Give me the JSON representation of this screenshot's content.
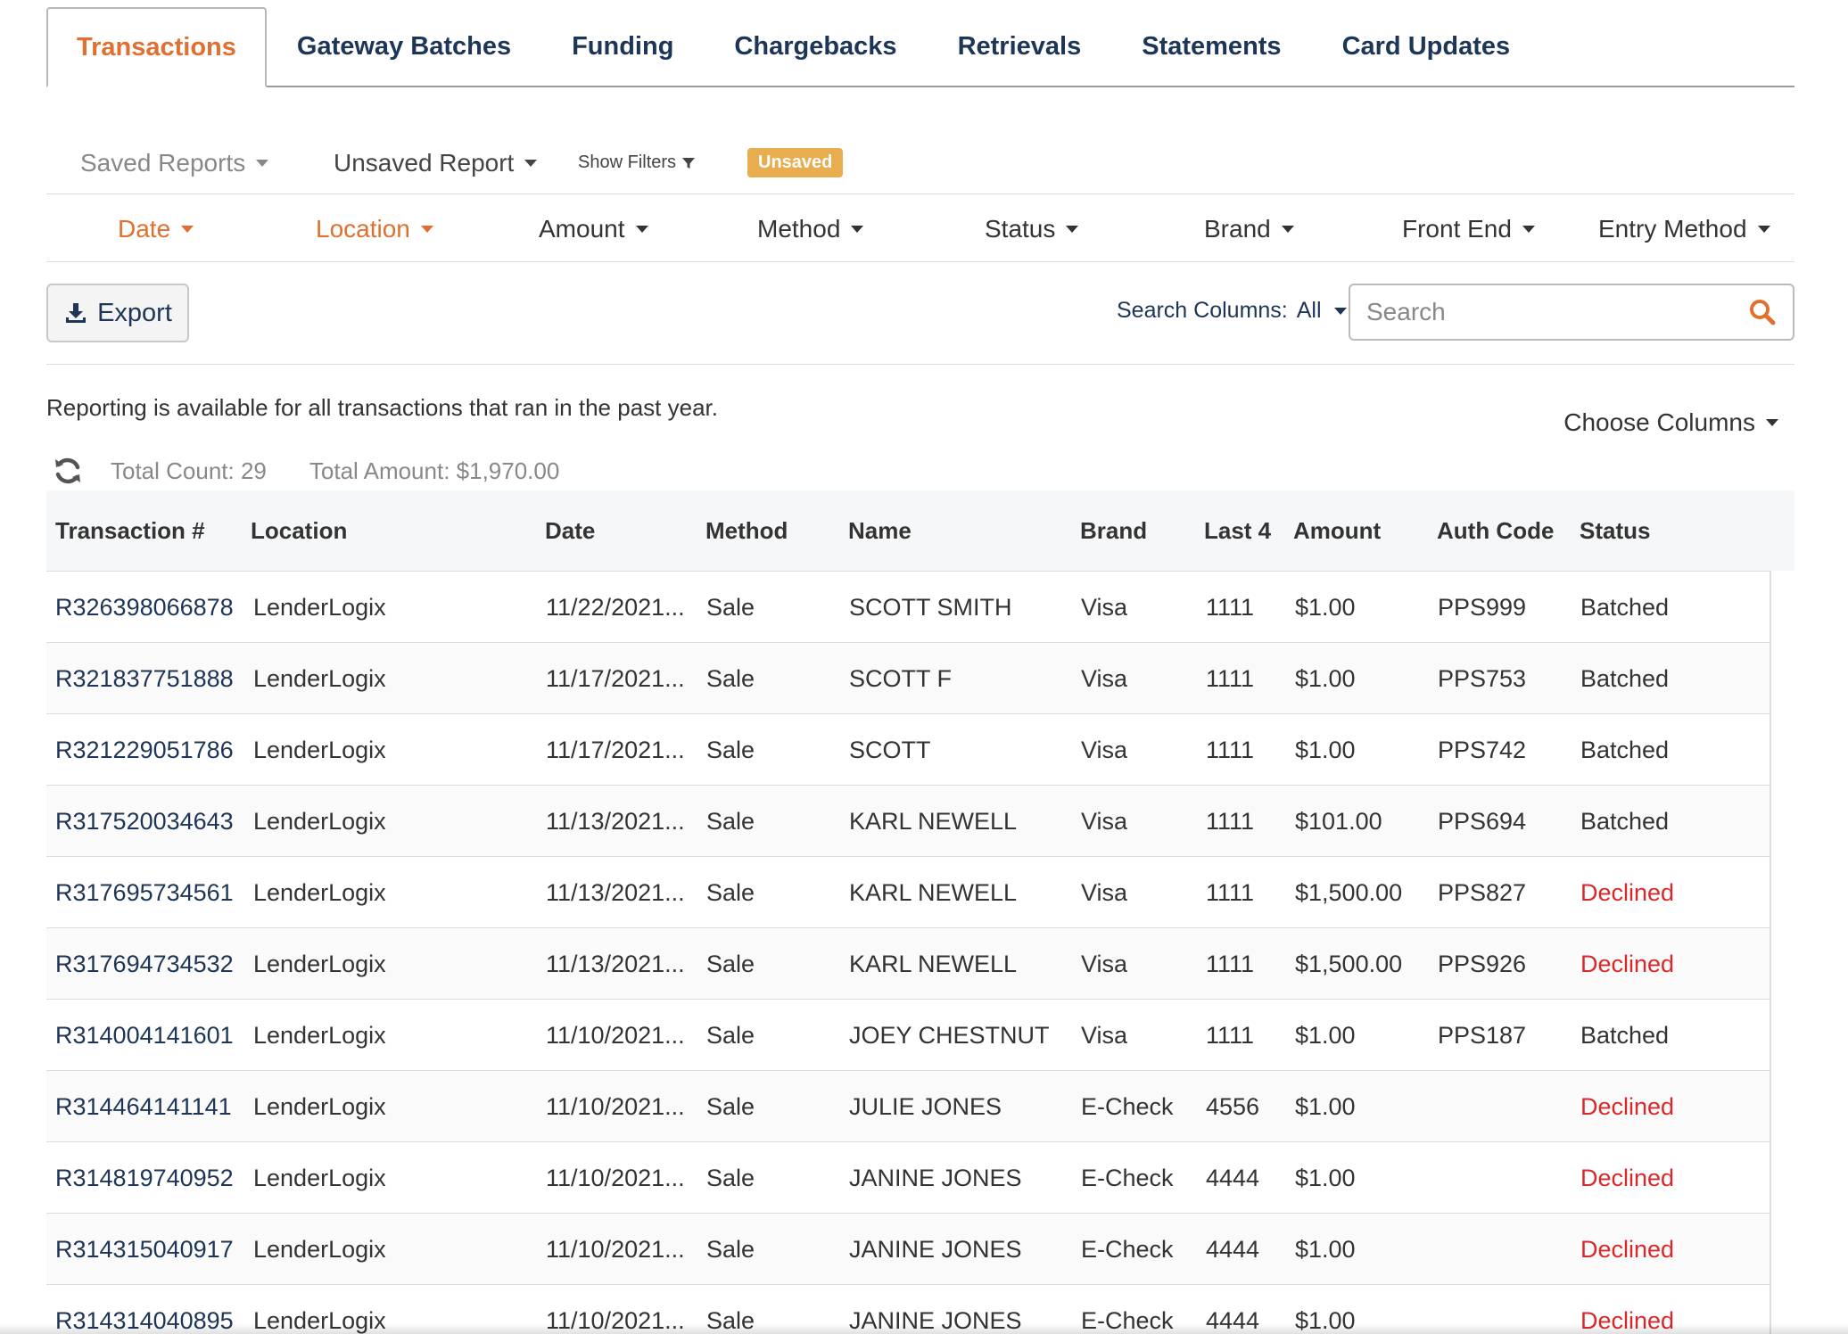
{
  "tabs": [
    {
      "label": "Transactions",
      "active": true
    },
    {
      "label": "Gateway Batches"
    },
    {
      "label": "Funding"
    },
    {
      "label": "Chargebacks"
    },
    {
      "label": "Retrievals"
    },
    {
      "label": "Statements"
    },
    {
      "label": "Card Updates"
    }
  ],
  "toolbar": {
    "saved_reports": "Saved Reports",
    "unsaved_report": "Unsaved Report",
    "show_filters": "Show Filters",
    "badge": "Unsaved"
  },
  "filters": [
    {
      "label": "Date",
      "active": true
    },
    {
      "label": "Location",
      "active": true
    },
    {
      "label": "Amount"
    },
    {
      "label": "Method"
    },
    {
      "label": "Status"
    },
    {
      "label": "Brand"
    },
    {
      "label": "Front End"
    },
    {
      "label": "Entry Method"
    }
  ],
  "export_label": "Export",
  "search": {
    "columns_label": "Search Columns:",
    "columns_value": "All",
    "placeholder": "Search",
    "value": ""
  },
  "info_text": "Reporting is available for all transactions that ran in the past year.",
  "choose_columns": "Choose Columns",
  "totals": {
    "count": "Total Count: 29",
    "amount": "Total Amount: $1,970.00"
  },
  "table": {
    "headers": [
      "Transaction #",
      "Location",
      "Date",
      "Method",
      "Name",
      "Brand",
      "Last 4",
      "Amount",
      "Auth Code",
      "Status"
    ],
    "rows": [
      [
        "R326398066878",
        "LenderLogix",
        "11/22/2021...",
        "Sale",
        "SCOTT SMITH",
        "Visa",
        "1111",
        "$1.00",
        "PPS999",
        "Batched"
      ],
      [
        "R321837751888",
        "LenderLogix",
        "11/17/2021...",
        "Sale",
        "SCOTT F",
        "Visa",
        "1111",
        "$1.00",
        "PPS753",
        "Batched"
      ],
      [
        "R321229051786",
        "LenderLogix",
        "11/17/2021...",
        "Sale",
        "SCOTT",
        "Visa",
        "1111",
        "$1.00",
        "PPS742",
        "Batched"
      ],
      [
        "R317520034643",
        "LenderLogix",
        "11/13/2021...",
        "Sale",
        "KARL NEWELL",
        "Visa",
        "1111",
        "$101.00",
        "PPS694",
        "Batched"
      ],
      [
        "R317695734561",
        "LenderLogix",
        "11/13/2021...",
        "Sale",
        "KARL NEWELL",
        "Visa",
        "1111",
        "$1,500.00",
        "PPS827",
        "Declined"
      ],
      [
        "R317694734532",
        "LenderLogix",
        "11/13/2021...",
        "Sale",
        "KARL NEWELL",
        "Visa",
        "1111",
        "$1,500.00",
        "PPS926",
        "Declined"
      ],
      [
        "R314004141601",
        "LenderLogix",
        "11/10/2021...",
        "Sale",
        "JOEY CHESTNUT",
        "Visa",
        "1111",
        "$1.00",
        "PPS187",
        "Batched"
      ],
      [
        "R314464141141",
        "LenderLogix",
        "11/10/2021...",
        "Sale",
        "JULIE JONES",
        "E-Check",
        "4556",
        "$1.00",
        "",
        "Declined"
      ],
      [
        "R314819740952",
        "LenderLogix",
        "11/10/2021...",
        "Sale",
        "JANINE JONES",
        "E-Check",
        "4444",
        "$1.00",
        "",
        "Declined"
      ],
      [
        "R314315040917",
        "LenderLogix",
        "11/10/2021...",
        "Sale",
        "JANINE JONES",
        "E-Check",
        "4444",
        "$1.00",
        "",
        "Declined"
      ],
      [
        "R314314040895",
        "LenderLogix",
        "11/10/2021...",
        "Sale",
        "JANINE JONES",
        "E-Check",
        "4444",
        "$1.00",
        "",
        "Declined"
      ]
    ]
  },
  "colors": {
    "accent": "#e07030",
    "navy": "#1d3557",
    "declined": "#d9282a",
    "badge": "#e8ad4e"
  }
}
